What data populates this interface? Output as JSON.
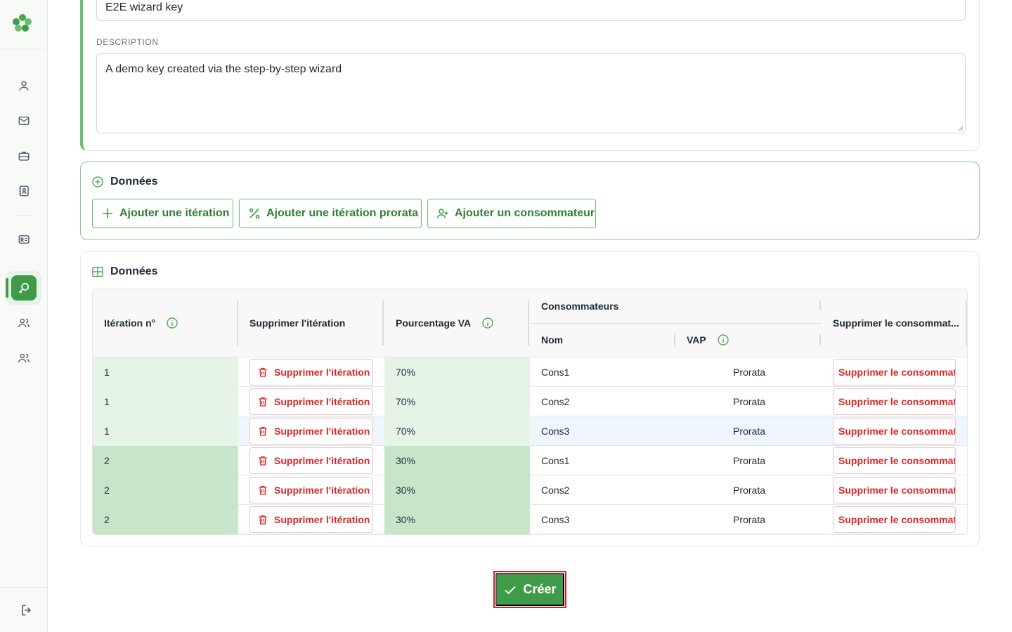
{
  "form": {
    "name_value": "E2E wizard key",
    "description_label": "DESCRIPTION",
    "description_value": "A demo key created via the step-by-step wizard"
  },
  "actions_section": {
    "title": "Données",
    "buttons": [
      {
        "label": "Ajouter une itération",
        "icon": "plus-icon"
      },
      {
        "label": "Ajouter une itération prorata",
        "icon": "percent-icon"
      },
      {
        "label": "Ajouter un consommateur",
        "icon": "user-plus-icon"
      }
    ]
  },
  "table_section": {
    "title": "Données",
    "headers": {
      "iteration": "Itération n°",
      "delete_iteration": "Supprimer l'itération",
      "percentage": "Pourcentage VA",
      "consumers_group": "Consommateurs",
      "name": "Nom",
      "vap": "VAP",
      "delete_consumer": "Supprimer le consommat..."
    },
    "rows": [
      {
        "iteration": "1",
        "delete_label": "Supprimer l'itération",
        "percentage": "70%",
        "name": "Cons1",
        "vap": "Prorata",
        "delete_consumer_label": "Supprimer le consommateur"
      },
      {
        "iteration": "1",
        "delete_label": "Supprimer l'itération",
        "percentage": "70%",
        "name": "Cons2",
        "vap": "Prorata",
        "delete_consumer_label": "Supprimer le consommateur"
      },
      {
        "iteration": "1",
        "delete_label": "Supprimer l'itération",
        "percentage": "70%",
        "name": "Cons3",
        "vap": "Prorata",
        "delete_consumer_label": "Supprimer le consommateur"
      },
      {
        "iteration": "2",
        "delete_label": "Supprimer l'itération",
        "percentage": "30%",
        "name": "Cons1",
        "vap": "Prorata",
        "delete_consumer_label": "Supprimer le consommateur"
      },
      {
        "iteration": "2",
        "delete_label": "Supprimer l'itération",
        "percentage": "30%",
        "name": "Cons2",
        "vap": "Prorata",
        "delete_consumer_label": "Supprimer le consommateur"
      },
      {
        "iteration": "2",
        "delete_label": "Supprimer l'itération",
        "percentage": "30%",
        "name": "Cons3",
        "vap": "Prorata",
        "delete_consumer_label": "Supprimer le consommateur"
      }
    ]
  },
  "create_button": {
    "label": "Créer"
  },
  "sidebar": {
    "items": [
      "user-icon",
      "mail-icon",
      "briefcase-icon",
      "contact-book-icon",
      "id-card-icon",
      "key-search-icon",
      "users-icon",
      "team-icon"
    ],
    "logout_icon": "logout-icon"
  },
  "colors": {
    "brand_green": "#3f9b47",
    "danger_red": "#dc2626",
    "iteration1_bg": "#e6f4e7",
    "iteration2_bg": "#c7e6c9"
  }
}
